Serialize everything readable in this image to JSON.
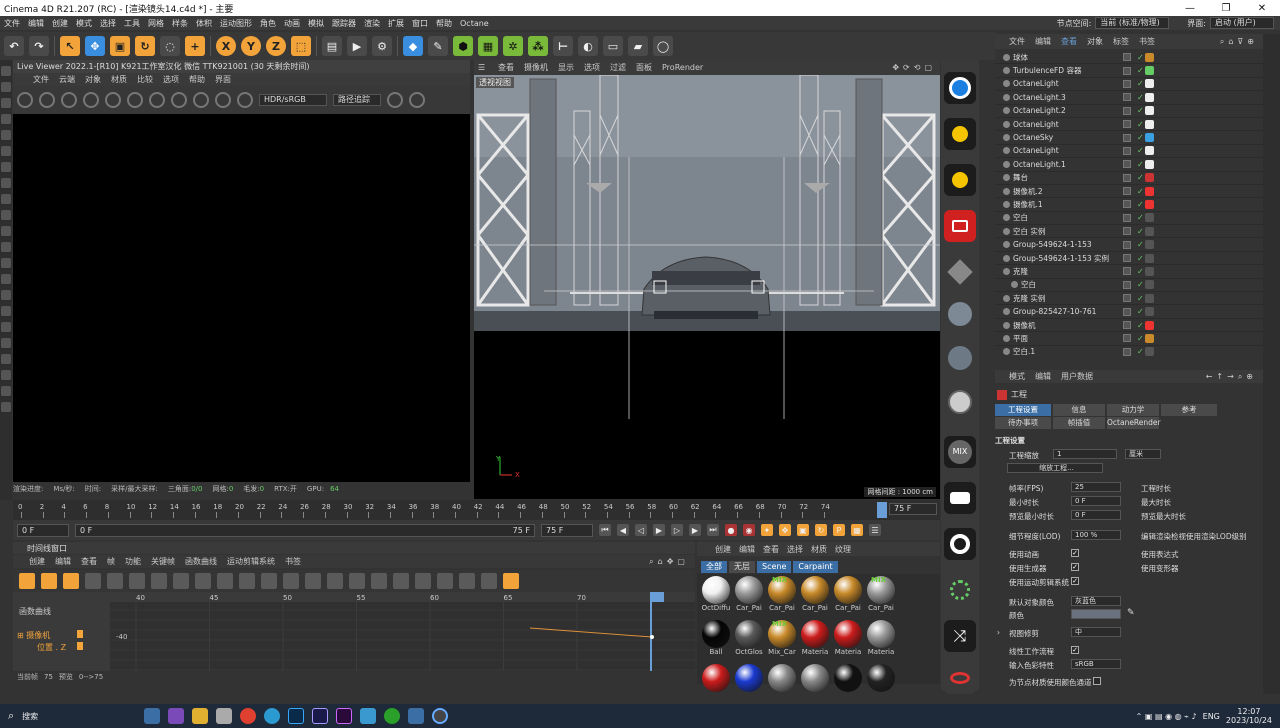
{
  "window": {
    "title": "Cinema 4D R21.207 (RC) - [渲染镜头14.c4d *] - 主要",
    "controls": [
      "—",
      "❐",
      "✕"
    ]
  },
  "menubar": {
    "items": [
      "文件",
      "编辑",
      "创建",
      "模式",
      "选择",
      "工具",
      "网格",
      "样条",
      "体积",
      "运动图形",
      "角色",
      "动画",
      "模拟",
      "跟踪器",
      "渲染",
      "扩展",
      "窗口",
      "帮助",
      "Octane"
    ],
    "node_space_label": "节点空间:",
    "node_space_value": "当前 (标准/物理)",
    "interface_label": "界面:",
    "interface_value": "启动 (用户)"
  },
  "toolbar": {
    "axes": [
      "X",
      "Y",
      "Z"
    ]
  },
  "live_viewer": {
    "title": "Live Viewer 2022.1-[R10] K921工作室汉化 微信 TTK921001 (30 天剩余时间)",
    "menu": [
      "文件",
      "云端",
      "对象",
      "材质",
      "比较",
      "选项",
      "帮助",
      "界面"
    ],
    "color_space": "HDR/sRGB",
    "kernel": "路径追踪",
    "status": {
      "progress_label": "渲染进度:",
      "speed_label": "Ms/秒:",
      "time_label": "时间:",
      "samples_label": "采样/最大采样:",
      "triangles_label": "三角面:",
      "triangles_value": "0/0",
      "mesh_label": "网格:",
      "mesh_value": "0",
      "hair_label": "毛发:",
      "hair_value": "0",
      "rtx_label": "RTX:",
      "rtx_value": "开",
      "gpu_label": "GPU:",
      "gpu_value": "64"
    }
  },
  "viewport": {
    "menu": [
      "查看",
      "摄像机",
      "显示",
      "选项",
      "过滤",
      "面板",
      "ProRender"
    ],
    "label": "透视视图",
    "footer": "网格间距 : 1000 cm",
    "axis_y": "Y",
    "axis_x": "X"
  },
  "timeline": {
    "ticks": [
      "0",
      "2",
      "4",
      "6",
      "8",
      "10",
      "12",
      "14",
      "16",
      "18",
      "20",
      "22",
      "24",
      "26",
      "28",
      "30",
      "32",
      "34",
      "36",
      "38",
      "40",
      "42",
      "44",
      "46",
      "48",
      "50",
      "52",
      "54",
      "56",
      "58",
      "60",
      "62",
      "64",
      "66",
      "68",
      "70",
      "72",
      "74"
    ],
    "current": "75 F",
    "start": "0 F",
    "field_a": "0 F",
    "end_a": "75 F",
    "end_b": "75 F"
  },
  "timeline_window": {
    "title": "时间线窗口",
    "menu": [
      "创建",
      "编辑",
      "查看",
      "帧",
      "功能",
      "关键帧",
      "函数曲线",
      "运动剪辑系统",
      "书签"
    ],
    "panel_label": "函数曲线",
    "ruler": [
      "40",
      "45",
      "50",
      "55",
      "60",
      "65",
      "70",
      "75"
    ],
    "track_object": "摄像机",
    "track_param": "位置 . Z",
    "value_label": "-40",
    "status_frame_label": "当前帧",
    "status_frame": "75",
    "status_preview_label": "预览",
    "status_preview": "0-->75"
  },
  "materials": {
    "menu": [
      "创建",
      "编辑",
      "查看",
      "选择",
      "材质",
      "纹理"
    ],
    "tabs": [
      "全部",
      "无层",
      "Scene",
      "Carpaint"
    ],
    "row1": [
      {
        "label": "OctDiffu",
        "color": "#f0f0f0"
      },
      {
        "label": "Car_Pai",
        "color": "#9a9a9a"
      },
      {
        "label": "Car_Pai",
        "color": "#c88a2a",
        "badge": "MIX"
      },
      {
        "label": "Car_Pai",
        "color": "#c88a2a"
      },
      {
        "label": "Car_Pai",
        "color": "#c88a2a"
      },
      {
        "label": "Car_Pai",
        "color": "#9a9a9a",
        "badge": "MIX"
      }
    ],
    "row2": [
      {
        "label": "Ball",
        "color": "#050505"
      },
      {
        "label": "OctGlos",
        "color": "#5a5a5a"
      },
      {
        "label": "Mix_Car",
        "color": "#c88a2a",
        "badge": "MIX"
      },
      {
        "label": "Materia",
        "color": "#cc1c1c"
      },
      {
        "label": "Materia",
        "color": "#cc1c1c"
      },
      {
        "label": "Materia",
        "color": "#9a9a9a"
      }
    ],
    "row3_colors": [
      "#cc1c1c",
      "#1a3ad0",
      "#888888",
      "#888888",
      "#111111",
      "#222222"
    ]
  },
  "object_manager": {
    "menu": [
      "文件",
      "编辑",
      "查看",
      "对象",
      "标签",
      "书签"
    ],
    "rows": [
      {
        "name": "球体",
        "indent": 0,
        "tag": "#c88a2a"
      },
      {
        "name": "TurbulenceFD 容器",
        "indent": 0,
        "tag": "#6c6"
      },
      {
        "name": "OctaneLight",
        "indent": 0,
        "tag": "#eee"
      },
      {
        "name": "OctaneLight.3",
        "indent": 0,
        "tag": "#eee"
      },
      {
        "name": "OctaneLight.2",
        "indent": 0,
        "tag": "#eee"
      },
      {
        "name": "OctaneLight",
        "indent": 0,
        "tag": "#eee"
      },
      {
        "name": "OctaneSky",
        "indent": 0,
        "tag": "#3aa0e0"
      },
      {
        "name": "OctaneLight",
        "indent": 0,
        "tag": "#eee"
      },
      {
        "name": "OctaneLight.1",
        "indent": 0,
        "tag": "#eee"
      },
      {
        "name": "舞台",
        "indent": 0,
        "tag": "#c33"
      },
      {
        "name": "摄像机.2",
        "indent": 0,
        "tag": "#e33"
      },
      {
        "name": "摄像机.1",
        "indent": 0,
        "tag": "#e33"
      },
      {
        "name": "空白",
        "indent": 0,
        "tag": "#555"
      },
      {
        "name": "空白 实例",
        "indent": 0,
        "tag": "#555"
      },
      {
        "name": "Group-549624-1-153",
        "indent": 0,
        "tag": "#555"
      },
      {
        "name": "Group-549624-1-153 实例",
        "indent": 0,
        "tag": "#555"
      },
      {
        "name": "克隆",
        "indent": 0,
        "tag": "#555"
      },
      {
        "name": "空白",
        "indent": 1,
        "tag": "#555"
      },
      {
        "name": "克隆 实例",
        "indent": 0,
        "tag": "#555"
      },
      {
        "name": "Group-825427-10-761",
        "indent": 0,
        "tag": "#555"
      },
      {
        "name": "摄像机",
        "indent": 0,
        "tag": "#e33"
      },
      {
        "name": "平面",
        "indent": 0,
        "tag": "#c88a2a"
      },
      {
        "name": "空白.1",
        "indent": 0,
        "tag": "#555"
      }
    ]
  },
  "attribute_manager": {
    "menu": [
      "模式",
      "编辑",
      "用户数据"
    ],
    "project_label": "工程",
    "tabs_row1": [
      "工程设置",
      "信息",
      "动力学",
      "参考"
    ],
    "tabs_row2": [
      "待办事项",
      "帧插值",
      "OctaneRender"
    ],
    "section": "工程设置",
    "scale_label": "工程缩放",
    "scale_value": "1",
    "scale_unit": "厘米",
    "scale_button": "缩放工程...",
    "fps_label": "帧率(FPS)",
    "fps_value": "25",
    "duration_label": "工程时长",
    "min_time_label": "最小时长",
    "min_time_value": "0 F",
    "max_time_label": "最大时长",
    "preview_min_label": "预览最小时长",
    "preview_min_value": "0 F",
    "preview_max_label": "预览最大时长",
    "lod_label": "细节程度(LOD)",
    "lod_value": "100 %",
    "lod_check_label": "编辑渲染检视使用渲染LOD级别",
    "use_anim_label": "使用动画",
    "use_expr_label": "使用表达式",
    "use_gen_label": "使用生成器",
    "use_deform_label": "使用变形器",
    "use_motion_label": "使用运动剪辑系统",
    "default_color_label": "默认对象颜色",
    "default_color_value": "灰蓝色",
    "color_label": "颜色",
    "view_clip_label": "视图修剪",
    "view_clip_value": "中",
    "linear_label": "线性工作流程",
    "input_color_label": "输入色彩特性",
    "input_color_value": "sRGB",
    "node_mat_label": "为节点材质使用颜色通道"
  },
  "taskbar": {
    "search": "搜索",
    "lang": "ENG",
    "time": "12:07",
    "date": "2023/10/24"
  }
}
